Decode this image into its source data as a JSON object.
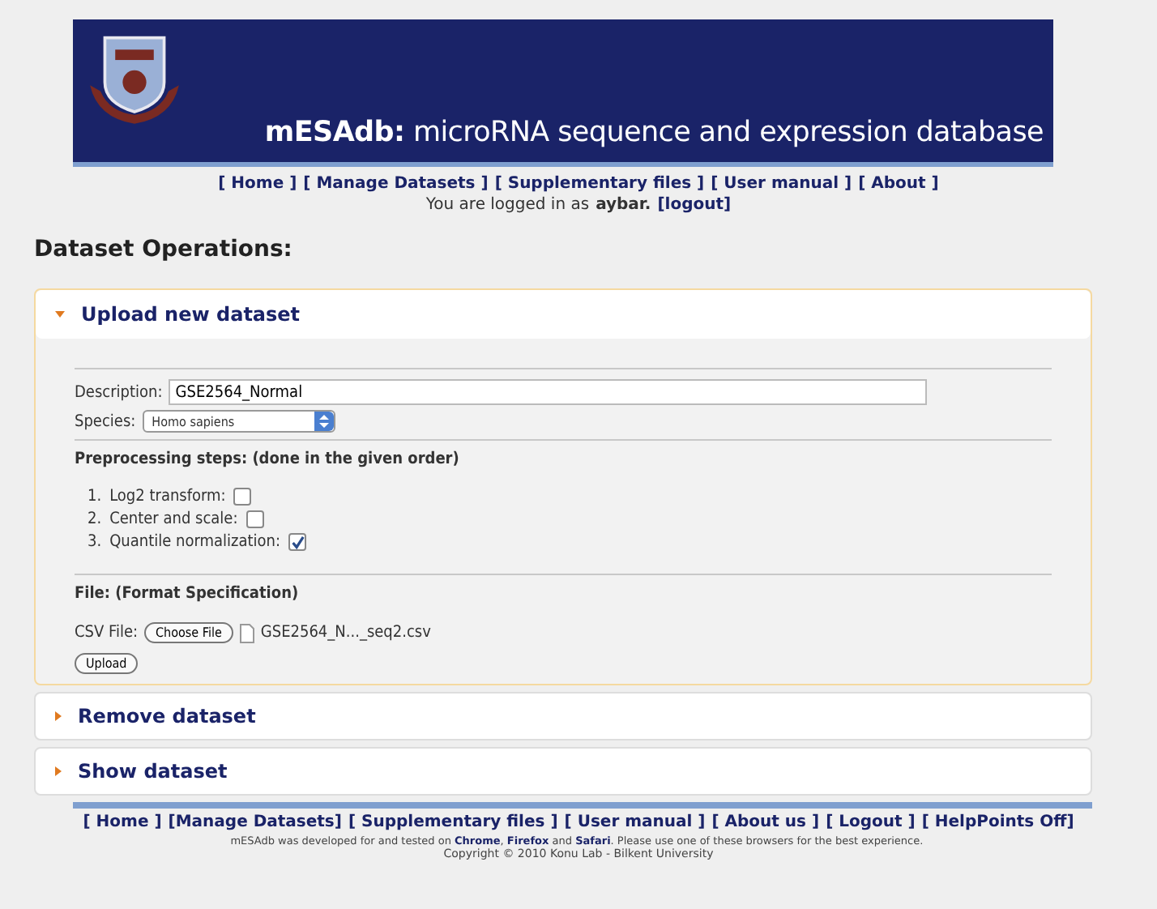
{
  "banner": {
    "brand": "mESAdb:",
    "title": "microRNA sequence and expression database"
  },
  "nav": [
    "[ Home ]",
    "[ Manage Datasets ]",
    "[ Supplementary files ]",
    "[ User manual ]",
    "[ About ]"
  ],
  "login": {
    "text": "You are logged in as",
    "user": "aybar.",
    "logout": "[logout]"
  },
  "heading": "Dataset Operations:",
  "sections": [
    {
      "title": "Upload new dataset",
      "expanded": true
    },
    {
      "title": "Remove dataset",
      "expanded": false
    },
    {
      "title": "Show dataset",
      "expanded": false
    }
  ],
  "form": {
    "description_label": "Description:",
    "description_value": "GSE2564_Normal",
    "species_label": "Species:",
    "species_value": "Homo sapiens",
    "steps_heading": "Preprocessing steps: (done in the given order)",
    "steps": [
      {
        "number": "1.",
        "label": "Log2 transform:",
        "checked": false
      },
      {
        "number": "2.",
        "label": "Center and scale:",
        "checked": false
      },
      {
        "number": "3.",
        "label": "Quantile normalization:",
        "checked": true
      }
    ],
    "file_heading": "File: (Format Specification)",
    "csv_label": "CSV File:",
    "choose_button": "Choose File",
    "file_name": "GSE2564_N..._seq2.csv",
    "upload_button": "Upload"
  },
  "footer_nav": [
    "[ Home ]",
    "[Manage Datasets]",
    "[ Supplementary files ]",
    "[ User manual ]",
    "[ About us ]",
    "[ Logout ]",
    "[ HelpPoints Off]"
  ],
  "footer_note": [
    {
      "kind": "text",
      "text": "mESAdb was developed for and tested on"
    },
    {
      "kind": "link",
      "text": "Chrome"
    },
    {
      "kind": "text",
      "text": ","
    },
    {
      "kind": "link",
      "text": "Firefox"
    },
    {
      "kind": "text",
      "text": "and"
    },
    {
      "kind": "link",
      "text": "Safari"
    },
    {
      "kind": "text",
      "text": ". Please use one of these browsers for the best experience."
    }
  ],
  "copyright": "Copyright © 2010 Konu Lab - Bilkent University"
}
